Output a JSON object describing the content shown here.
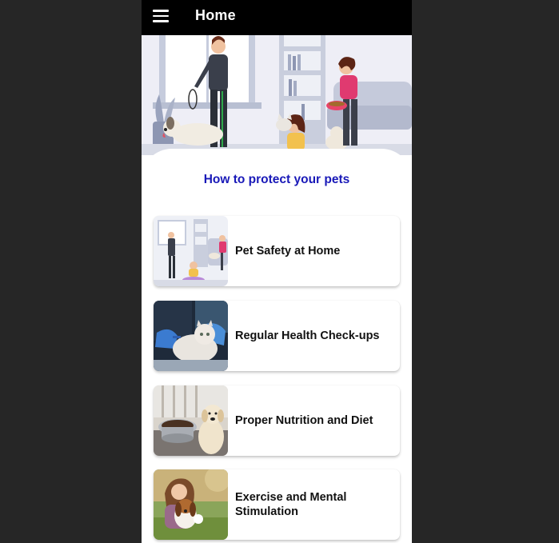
{
  "app_bar": {
    "title": "Home",
    "menu_icon": "hamburger-menu-icon"
  },
  "hero": {
    "illustration": "family-with-pets-illustration"
  },
  "section": {
    "title": "How to protect your pets"
  },
  "topics": [
    {
      "title": "Pet Safety at Home",
      "image": "family-pets-illustration"
    },
    {
      "title": "Regular Health Check-ups",
      "image": "vet-examining-cat-photo"
    },
    {
      "title": "Proper Nutrition and Diet",
      "image": "dog-with-food-bowl-photo"
    },
    {
      "title": "Exercise and Mental Stimulation",
      "image": "woman-with-beagle-photo"
    }
  ],
  "colors": {
    "app_bar": "#000000",
    "section_title": "#1919b8",
    "background": "#262626"
  }
}
